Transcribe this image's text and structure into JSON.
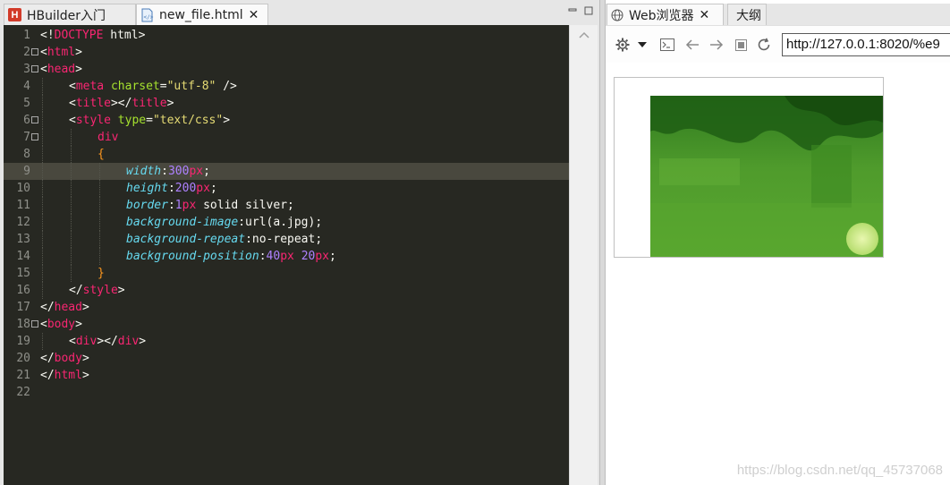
{
  "editor": {
    "tabs": [
      {
        "label": "HBuilder入门",
        "icon": "hbuilder-logo-icon",
        "active": false
      },
      {
        "label": "new_file.html",
        "icon": "html-file-icon",
        "active": true
      }
    ],
    "close_glyph": "✕",
    "logo_letter": "H",
    "lines": [
      {
        "n": "1",
        "fold": false,
        "indent": 0,
        "tokens": [
          [
            "punc",
            "<!"
          ],
          [
            "tag",
            "DOCTYPE"
          ],
          [
            "punc",
            " html>"
          ]
        ]
      },
      {
        "n": "2",
        "fold": true,
        "indent": 0,
        "tokens": [
          [
            "punc",
            "<"
          ],
          [
            "tag",
            "html"
          ],
          [
            "punc",
            ">"
          ]
        ]
      },
      {
        "n": "3",
        "fold": true,
        "indent": 0,
        "tokens": [
          [
            "punc",
            "<"
          ],
          [
            "tag",
            "head"
          ],
          [
            "punc",
            ">"
          ]
        ]
      },
      {
        "n": "4",
        "fold": false,
        "indent": 1,
        "tokens": [
          [
            "punc",
            "<"
          ],
          [
            "tag",
            "meta"
          ],
          [
            "punc",
            " "
          ],
          [
            "attr",
            "charset"
          ],
          [
            "punc",
            "="
          ],
          [
            "str",
            "\"utf-8\""
          ],
          [
            "punc",
            " />"
          ]
        ]
      },
      {
        "n": "5",
        "fold": false,
        "indent": 1,
        "tokens": [
          [
            "punc",
            "<"
          ],
          [
            "tag",
            "title"
          ],
          [
            "punc",
            "></"
          ],
          [
            "tag",
            "title"
          ],
          [
            "punc",
            ">"
          ]
        ]
      },
      {
        "n": "6",
        "fold": true,
        "indent": 1,
        "tokens": [
          [
            "punc",
            "<"
          ],
          [
            "tag",
            "style"
          ],
          [
            "punc",
            " "
          ],
          [
            "attr",
            "type"
          ],
          [
            "punc",
            "="
          ],
          [
            "str",
            "\"text/css\""
          ],
          [
            "punc",
            ">"
          ]
        ]
      },
      {
        "n": "7",
        "fold": true,
        "indent": 2,
        "tokens": [
          [
            "tag",
            "div"
          ]
        ]
      },
      {
        "n": "8",
        "fold": false,
        "indent": 2,
        "tokens": [
          [
            "brace",
            "{"
          ]
        ]
      },
      {
        "n": "9",
        "fold": false,
        "indent": 3,
        "highlight": true,
        "tokens": [
          [
            "prop",
            "width"
          ],
          [
            "punc",
            ":"
          ],
          [
            "num",
            "300"
          ],
          [
            "tag",
            "px"
          ],
          [
            "punc",
            ";"
          ]
        ]
      },
      {
        "n": "10",
        "fold": false,
        "indent": 3,
        "tokens": [
          [
            "prop",
            "height"
          ],
          [
            "punc",
            ":"
          ],
          [
            "num",
            "200"
          ],
          [
            "tag",
            "px"
          ],
          [
            "punc",
            ";"
          ]
        ]
      },
      {
        "n": "11",
        "fold": false,
        "indent": 3,
        "tokens": [
          [
            "prop",
            "border"
          ],
          [
            "punc",
            ":"
          ],
          [
            "num",
            "1"
          ],
          [
            "tag",
            "px"
          ],
          [
            "punc",
            " solid silver;"
          ]
        ]
      },
      {
        "n": "12",
        "fold": false,
        "indent": 3,
        "tokens": [
          [
            "prop",
            "background-image"
          ],
          [
            "punc",
            ":url(a.jpg);"
          ]
        ]
      },
      {
        "n": "13",
        "fold": false,
        "indent": 3,
        "tokens": [
          [
            "prop",
            "background-repeat"
          ],
          [
            "punc",
            ":no-repeat;"
          ]
        ]
      },
      {
        "n": "14",
        "fold": false,
        "indent": 3,
        "tokens": [
          [
            "prop",
            "background-position"
          ],
          [
            "punc",
            ":"
          ],
          [
            "num",
            "40"
          ],
          [
            "tag",
            "px"
          ],
          [
            "punc",
            " "
          ],
          [
            "num",
            "20"
          ],
          [
            "tag",
            "px"
          ],
          [
            "punc",
            ";"
          ]
        ]
      },
      {
        "n": "15",
        "fold": false,
        "indent": 2,
        "tokens": [
          [
            "brace",
            "}"
          ]
        ]
      },
      {
        "n": "16",
        "fold": false,
        "indent": 1,
        "tokens": [
          [
            "punc",
            "</"
          ],
          [
            "tag",
            "style"
          ],
          [
            "punc",
            ">"
          ]
        ]
      },
      {
        "n": "17",
        "fold": false,
        "indent": 0,
        "tokens": [
          [
            "punc",
            "</"
          ],
          [
            "tag",
            "head"
          ],
          [
            "punc",
            ">"
          ]
        ]
      },
      {
        "n": "18",
        "fold": true,
        "indent": 0,
        "tokens": [
          [
            "punc",
            "<"
          ],
          [
            "tag",
            "body"
          ],
          [
            "punc",
            ">"
          ]
        ]
      },
      {
        "n": "19",
        "fold": false,
        "indent": 1,
        "tokens": [
          [
            "punc",
            "<"
          ],
          [
            "tag",
            "div"
          ],
          [
            "punc",
            "></"
          ],
          [
            "tag",
            "div"
          ],
          [
            "punc",
            ">"
          ]
        ]
      },
      {
        "n": "20",
        "fold": false,
        "indent": 0,
        "tokens": [
          [
            "punc",
            "</"
          ],
          [
            "tag",
            "body"
          ],
          [
            "punc",
            ">"
          ]
        ]
      },
      {
        "n": "21",
        "fold": false,
        "indent": 0,
        "tokens": [
          [
            "punc",
            "</"
          ],
          [
            "tag",
            "html"
          ],
          [
            "punc",
            ">"
          ]
        ]
      },
      {
        "n": "22",
        "fold": false,
        "indent": 0,
        "tokens": []
      }
    ]
  },
  "browser": {
    "tab_label": "Web浏览器",
    "outline_tab_label": "大纲",
    "url": "http://127.0.0.1:8020/%e9",
    "toolbar_icons": [
      "gear-icon",
      "dropdown-arrow-icon",
      "console-icon",
      "back-arrow-icon",
      "forward-arrow-icon",
      "stop-icon",
      "refresh-icon"
    ]
  },
  "watermark": "https://blog.csdn.net/qq_45737068",
  "colors": {
    "editor_bg": "#272822",
    "tag": "#f92672",
    "attr": "#a6e22e",
    "string": "#e6db74",
    "property": "#66d9ef",
    "number": "#ae81ff",
    "brace": "#fd971f"
  }
}
